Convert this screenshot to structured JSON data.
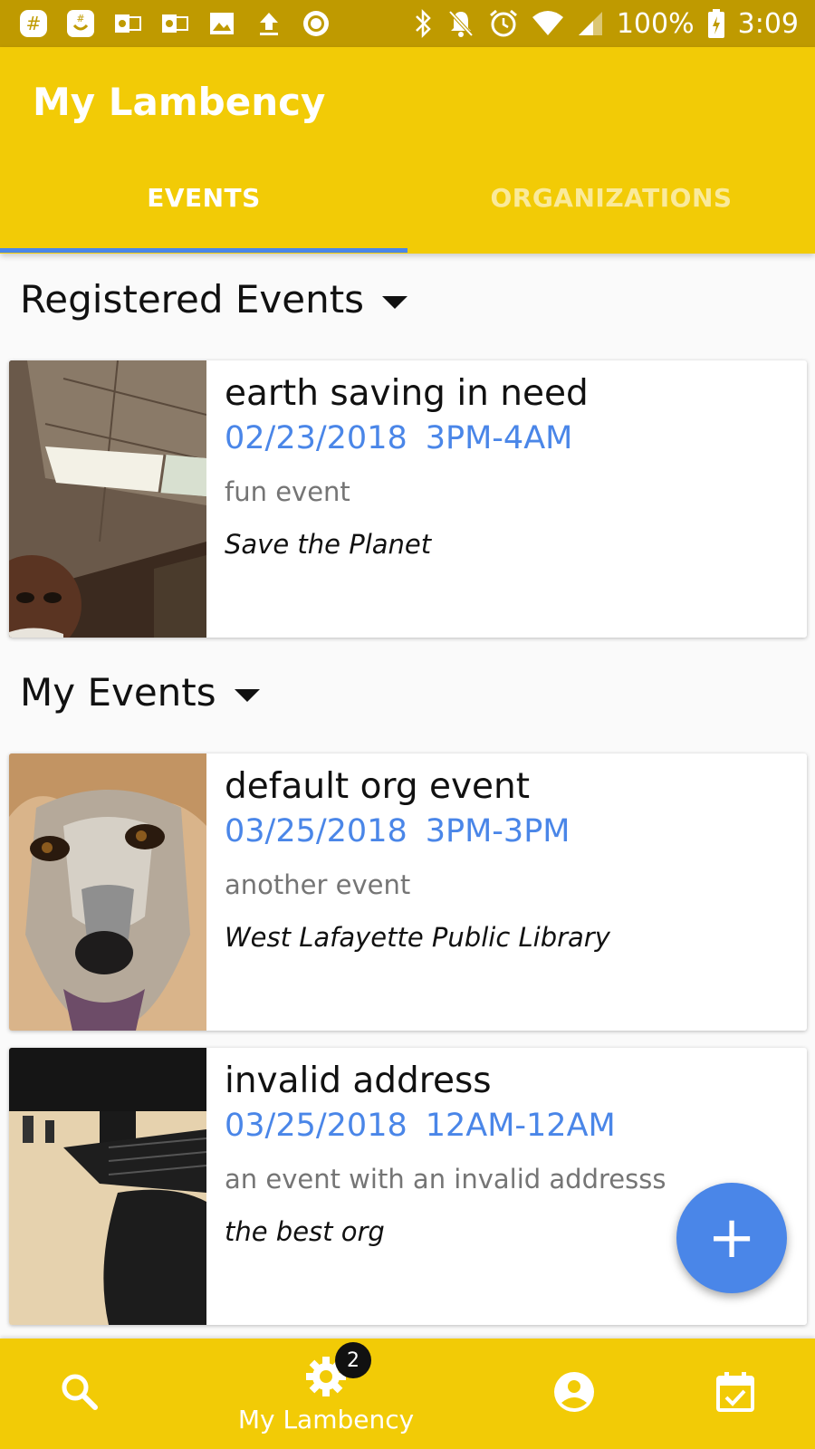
{
  "status_bar": {
    "battery": "100%",
    "time": "3:09",
    "left_icons": [
      "slack-icon",
      "groupme-icon",
      "outlook-icon",
      "outlook-icon",
      "image-icon",
      "upload-icon",
      "record-icon"
    ],
    "right_icons": [
      "bluetooth-icon",
      "notifications-off-icon",
      "alarm-icon",
      "wifi-icon",
      "signal-icon",
      "battery-charging-icon"
    ]
  },
  "app_bar": {
    "title": "My Lambency",
    "tabs": [
      {
        "label": "EVENTS",
        "selected": true
      },
      {
        "label": "ORGANIZATIONS",
        "selected": false
      }
    ]
  },
  "sections": {
    "registered": {
      "title": "Registered Events",
      "events": [
        {
          "name": "earth saving in need",
          "date": "02/23/2018",
          "time": "3PM-4AM",
          "description": "fun event",
          "organization": "Save the Planet"
        }
      ]
    },
    "mine": {
      "title": "My Events",
      "events": [
        {
          "name": "default org event",
          "date": "03/25/2018",
          "time": "3PM-3PM",
          "description": "another event",
          "organization": "West Lafayette Public Library"
        },
        {
          "name": "invalid address",
          "date": "03/25/2018",
          "time": "12AM-12AM",
          "description": "an event with an invalid addresss",
          "organization": "the best org"
        }
      ]
    }
  },
  "fab": {
    "label": "+"
  },
  "bottom_nav": {
    "items": [
      {
        "icon": "search-icon",
        "label": ""
      },
      {
        "icon": "gear-icon",
        "label": "My Lambency",
        "badge": "2"
      },
      {
        "icon": "account-circle-icon",
        "label": ""
      },
      {
        "icon": "calendar-check-icon",
        "label": ""
      }
    ]
  },
  "colors": {
    "primary": "#f2cb06",
    "status_bar": "#bf9a00",
    "accent": "#4a86e8"
  }
}
